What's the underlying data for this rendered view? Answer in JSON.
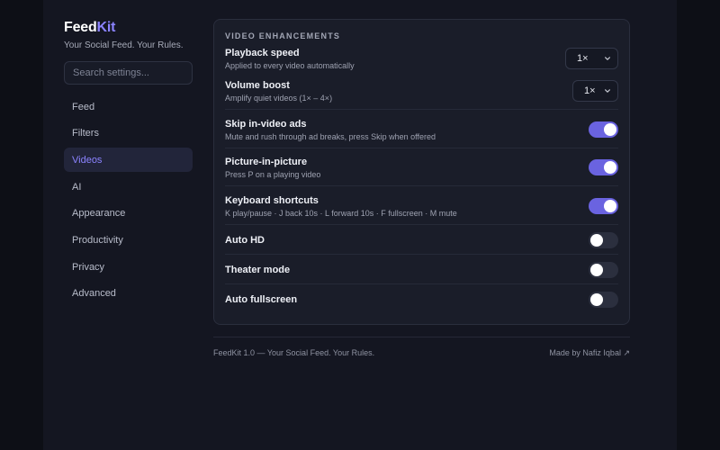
{
  "brand": {
    "name_part1": "Feed",
    "name_part2": "Kit",
    "tagline": "Your Social Feed. Your Rules."
  },
  "search": {
    "placeholder": "Search settings..."
  },
  "nav": {
    "items": [
      {
        "label": "Feed"
      },
      {
        "label": "Filters"
      },
      {
        "label": "Videos",
        "active": true
      },
      {
        "label": "AI"
      },
      {
        "label": "Appearance"
      },
      {
        "label": "Productivity"
      },
      {
        "label": "Privacy"
      },
      {
        "label": "Advanced"
      }
    ]
  },
  "section": {
    "title": "VIDEO ENHANCEMENTS",
    "playback": {
      "label": "Playback speed",
      "desc": "Applied to every video automatically",
      "value": "1×"
    },
    "volume": {
      "label": "Volume boost",
      "desc": "Amplify quiet videos (1× – 4×)",
      "value": "1×"
    },
    "skip_ads": {
      "label": "Skip in-video ads",
      "desc": "Mute and rush through ad breaks, press Skip when offered",
      "enabled": true
    },
    "pip": {
      "label": "Picture-in-picture",
      "desc": "Press P on a playing video",
      "enabled": true
    },
    "shortcuts": {
      "label": "Keyboard shortcuts",
      "desc": "K play/pause · J back 10s · L forward 10s · F fullscreen · M mute",
      "enabled": true
    },
    "auto_hd": {
      "label": "Auto HD",
      "enabled": false
    },
    "theater": {
      "label": "Theater mode",
      "enabled": false
    },
    "auto_fullscreen": {
      "label": "Auto fullscreen",
      "enabled": false
    }
  },
  "footer": {
    "left": "FeedKit 1.0 — Your Social Feed. Your Rules.",
    "right": "Made by Nafiz Iqbal ↗"
  },
  "colors": {
    "accent": "#8b83ff",
    "toggle_on": "#6a63e0",
    "background": "#0d0f16",
    "panel": "#141621"
  }
}
